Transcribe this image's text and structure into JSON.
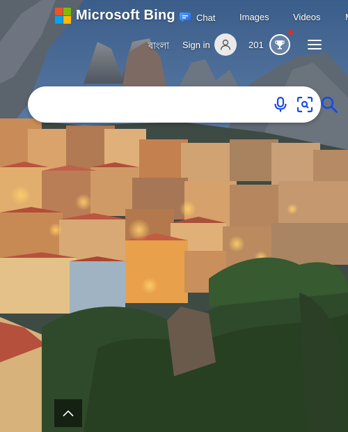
{
  "brand": {
    "name": "Microsoft Bing",
    "colors": [
      "#f25022",
      "#7fba00",
      "#00a4ef",
      "#ffb900"
    ]
  },
  "nav": {
    "chat_label": "Chat",
    "images_label": "Images",
    "videos_label": "Videos",
    "more_label": "M"
  },
  "header": {
    "language_label": "বাংলা",
    "signin_label": "Sign in",
    "rewards_points": "201"
  },
  "search": {
    "placeholder": "",
    "value": ""
  },
  "icons": {
    "chat": "chat-bubble-icon",
    "avatar": "user-avatar-icon",
    "rewards": "trophy-icon",
    "menu": "hamburger-menu-icon",
    "voice": "microphone-icon",
    "visual_search": "visual-search-icon",
    "search": "search-icon",
    "scroll_top": "chevron-up-icon"
  },
  "theme": {
    "accent": "#174ae4",
    "notification": "#d93025"
  }
}
